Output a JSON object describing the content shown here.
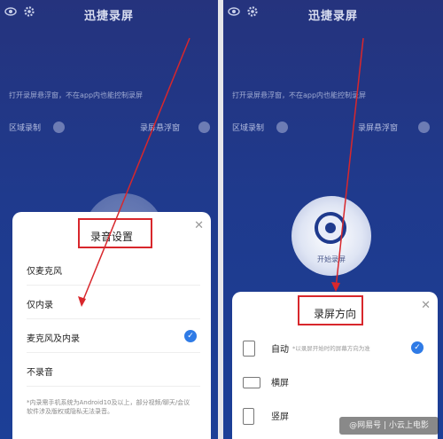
{
  "left": {
    "app_title": "迅捷录屏",
    "tip": "打开录屏悬浮窗，不在app内也能控制录屏",
    "floating_toggle_left": "区域录制",
    "floating_toggle_right": "录屏悬浮窗",
    "sheet": {
      "title": "录音设置",
      "options": [
        "仅麦克风",
        "仅内录",
        "麦克风及内录",
        "不录音"
      ],
      "selected_index": 2,
      "note": "*内录需手机系统为Android10及以上，部分视频/聊天/会议软件涉及版权或隐私无法录音。"
    }
  },
  "right": {
    "app_title": "迅捷录屏",
    "tip": "打开录屏悬浮窗，不在app内也能控制录屏",
    "floating_toggle_left": "区域录制",
    "floating_toggle_right": "录屏悬浮窗",
    "record_label": "开始录屏",
    "sheet": {
      "title": "录屏方向",
      "options": [
        {
          "label": "自动",
          "desc": "*以录屏开始时的屏幕方向为准",
          "icon": "auto-rotate-icon"
        },
        {
          "label": "横屏",
          "desc": "",
          "icon": "landscape-icon"
        },
        {
          "label": "竖屏",
          "desc": "",
          "icon": "portrait-icon"
        }
      ],
      "selected_index": 0
    }
  },
  "watermark": "@网易号 | 小云上电影",
  "colors": {
    "background_blue": "#1f3a8d",
    "highlight_red": "#d8272c",
    "check_blue": "#2f7be6"
  }
}
